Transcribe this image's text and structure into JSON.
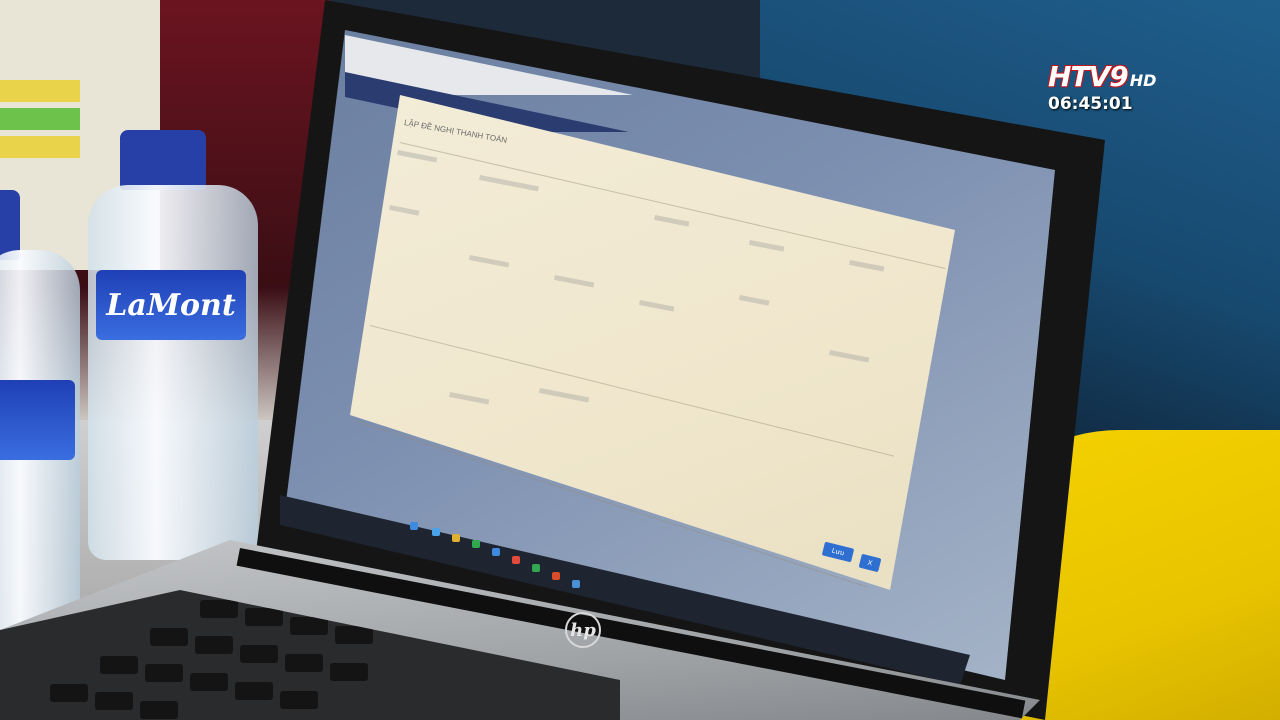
{
  "overlay": {
    "channel_name": "HTV9",
    "channel_quality": "HD",
    "clock": "06:45:01"
  },
  "laptop": {
    "brand_logo": "hp"
  },
  "bottle": {
    "brand": "LaMont"
  },
  "dialog": {
    "title": "LẬP ĐỀ NGHỊ THANH TOÁN",
    "buttons": [
      {
        "label": "Lưu",
        "color": "#2f6fd1"
      },
      {
        "label": "X",
        "color": "#2f6fd1"
      }
    ]
  },
  "colors": {
    "channel_red": "#c4141c",
    "screen_dialog": "#f3ecd7",
    "screen_header": "#2b3c70",
    "cloth_yellow": "#f4d100"
  }
}
